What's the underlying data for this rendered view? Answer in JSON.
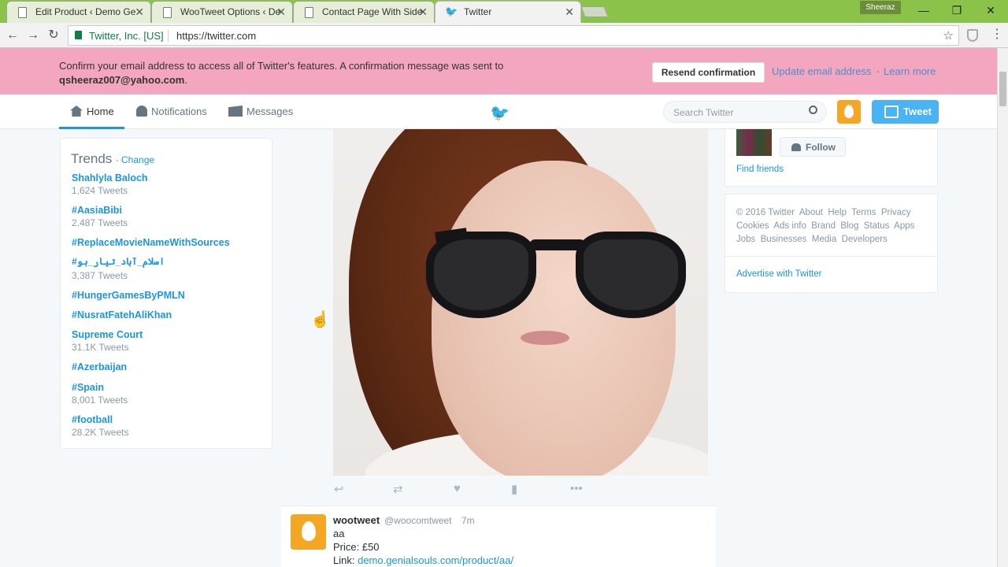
{
  "browser": {
    "tabs": [
      {
        "title": "Edit Product ‹ Demo Ge"
      },
      {
        "title": "WooTweet Options ‹ De"
      },
      {
        "title": "Contact Page With Side"
      },
      {
        "title": "Twitter"
      }
    ],
    "profile_name": "Sheeraz",
    "security_label": "Twitter, Inc. [US]",
    "url": "https://twitter.com"
  },
  "banner": {
    "message": "Confirm your email address to access all of Twitter's features. A confirmation message was sent to",
    "email": "qsheeraz007@yahoo.com",
    "email_suffix": ".",
    "resend_label": "Resend confirmation",
    "update_label": "Update email address",
    "separator": "·",
    "learn_more": "Learn more"
  },
  "nav": {
    "home": "Home",
    "notifications": "Notifications",
    "messages": "Messages",
    "search_placeholder": "Search Twitter",
    "tweet_button": "Tweet"
  },
  "trends": {
    "title": "Trends",
    "dot": "·",
    "change": "Change",
    "items": [
      {
        "name": "Shahlyla Baloch",
        "count": "1,624 Tweets"
      },
      {
        "name": "#AasiaBibi",
        "count": "2,487 Tweets"
      },
      {
        "name": "#ReplaceMovieNameWithSources",
        "count": ""
      },
      {
        "name": "#اسلام_آباد_تیار_ہو",
        "count": "3,387 Tweets"
      },
      {
        "name": "#HungerGamesByPMLN",
        "count": ""
      },
      {
        "name": "#NusratFatehAliKhan",
        "count": ""
      },
      {
        "name": "Supreme Court",
        "count": "31.1K Tweets"
      },
      {
        "name": "#Azerbaijan",
        "count": ""
      },
      {
        "name": "#Spain",
        "count": "8,001 Tweets"
      },
      {
        "name": "#football",
        "count": "28.2K Tweets"
      }
    ]
  },
  "tweet": {
    "name": "wootweet",
    "handle": "@woocomtweet",
    "time": "7m",
    "line1": "aa",
    "line2": "Price: £50",
    "link_label": "Link:",
    "link": "demo.genialsouls.com/product/aa/"
  },
  "sidebar": {
    "follow_label": "Follow",
    "find_friends": "Find friends",
    "footer_line1": [
      "© 2016 Twitter",
      "About",
      "Help",
      "Terms",
      "Privacy"
    ],
    "footer_line2": [
      "Cookies",
      "Ads info",
      "Brand",
      "Blog",
      "Status",
      "Apps"
    ],
    "footer_line3": [
      "Jobs",
      "Businesses",
      "Media",
      "Developers"
    ],
    "advertise": "Advertise with Twitter"
  },
  "colors": {
    "banner_bg": "#f4a6c0",
    "twitter_blue": "#1b95e0",
    "tab_bar": "#8bc34a",
    "egg_orange": "#f5a623"
  }
}
